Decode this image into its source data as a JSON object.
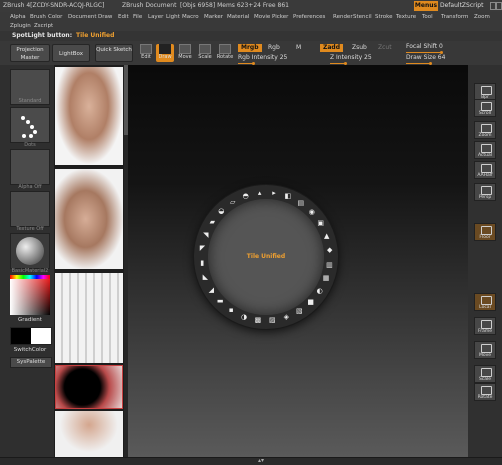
{
  "titlebar": {
    "app": "ZBrush 4[ZCDY-SNDR-ACQJ-RLGC]",
    "document": "ZBrush Document",
    "stats": "[Objs 6958] Mems 623+24 Free 861",
    "menus_label": "Menus",
    "script_label": "DefaultZScript"
  },
  "menubar": {
    "items": [
      "Alpha",
      "Brush",
      "Color",
      "Document",
      "Draw",
      "Edit",
      "File",
      "Layer",
      "Light",
      "Macro",
      "Marker",
      "Material",
      "Movie",
      "Picker",
      "Preferences",
      "Render",
      "Stencil",
      "Stroke",
      "Texture",
      "Tool",
      "Transform",
      "Zoom"
    ],
    "items2": [
      "Zplugin",
      "Zscript"
    ]
  },
  "spotlight": {
    "label": "SpotLight button:",
    "value": "Tile Unified"
  },
  "toolbar": {
    "projection_master": "Projection Master",
    "lightbox": "LightBox",
    "quick_sketch": "Quick Sketch",
    "edit": "Edit",
    "draw": "Draw",
    "move": "Move",
    "scale": "Scale",
    "rotate": "Rotate",
    "mrgb": "Mrgb",
    "rgb": "Rgb",
    "m": "M",
    "zadd": "Zadd",
    "zsub": "Zsub",
    "zcut": "Zcut",
    "rgb_intensity": "Rgb Intensity 25",
    "z_intensity": "Z Intensity 25",
    "focal_shift": "Focal Shift 0",
    "draw_size": "Draw Size 64",
    "rgb_intensity_level": 0.25,
    "z_intensity_level": 0.25,
    "focal_shift_level": 0.5,
    "draw_size_level": 0.35
  },
  "leftshelf": {
    "standard": "Standard",
    "dots": "Dots",
    "alpha_off": "Alpha Off",
    "texture_off": "Texture Off",
    "basic_material": "BasicMaterial2",
    "gradient": "Gradient",
    "switch_color": "SwitchColor",
    "syspalette": "SysPalette"
  },
  "canvas": {
    "center_label": "Tile Unified"
  },
  "rightshelf": {
    "buttons": [
      "Bpr",
      "Scroll",
      "Zoom",
      "Actual",
      "AAHalf",
      "Persp",
      "Floor",
      "Local",
      "Frame",
      "Move",
      "Scale",
      "Rotate"
    ]
  },
  "colors": {
    "accent": "#e08a1e",
    "panel": "#333333",
    "canvas_top": "#0a0a0a",
    "canvas_bottom": "#5a5a5a"
  }
}
